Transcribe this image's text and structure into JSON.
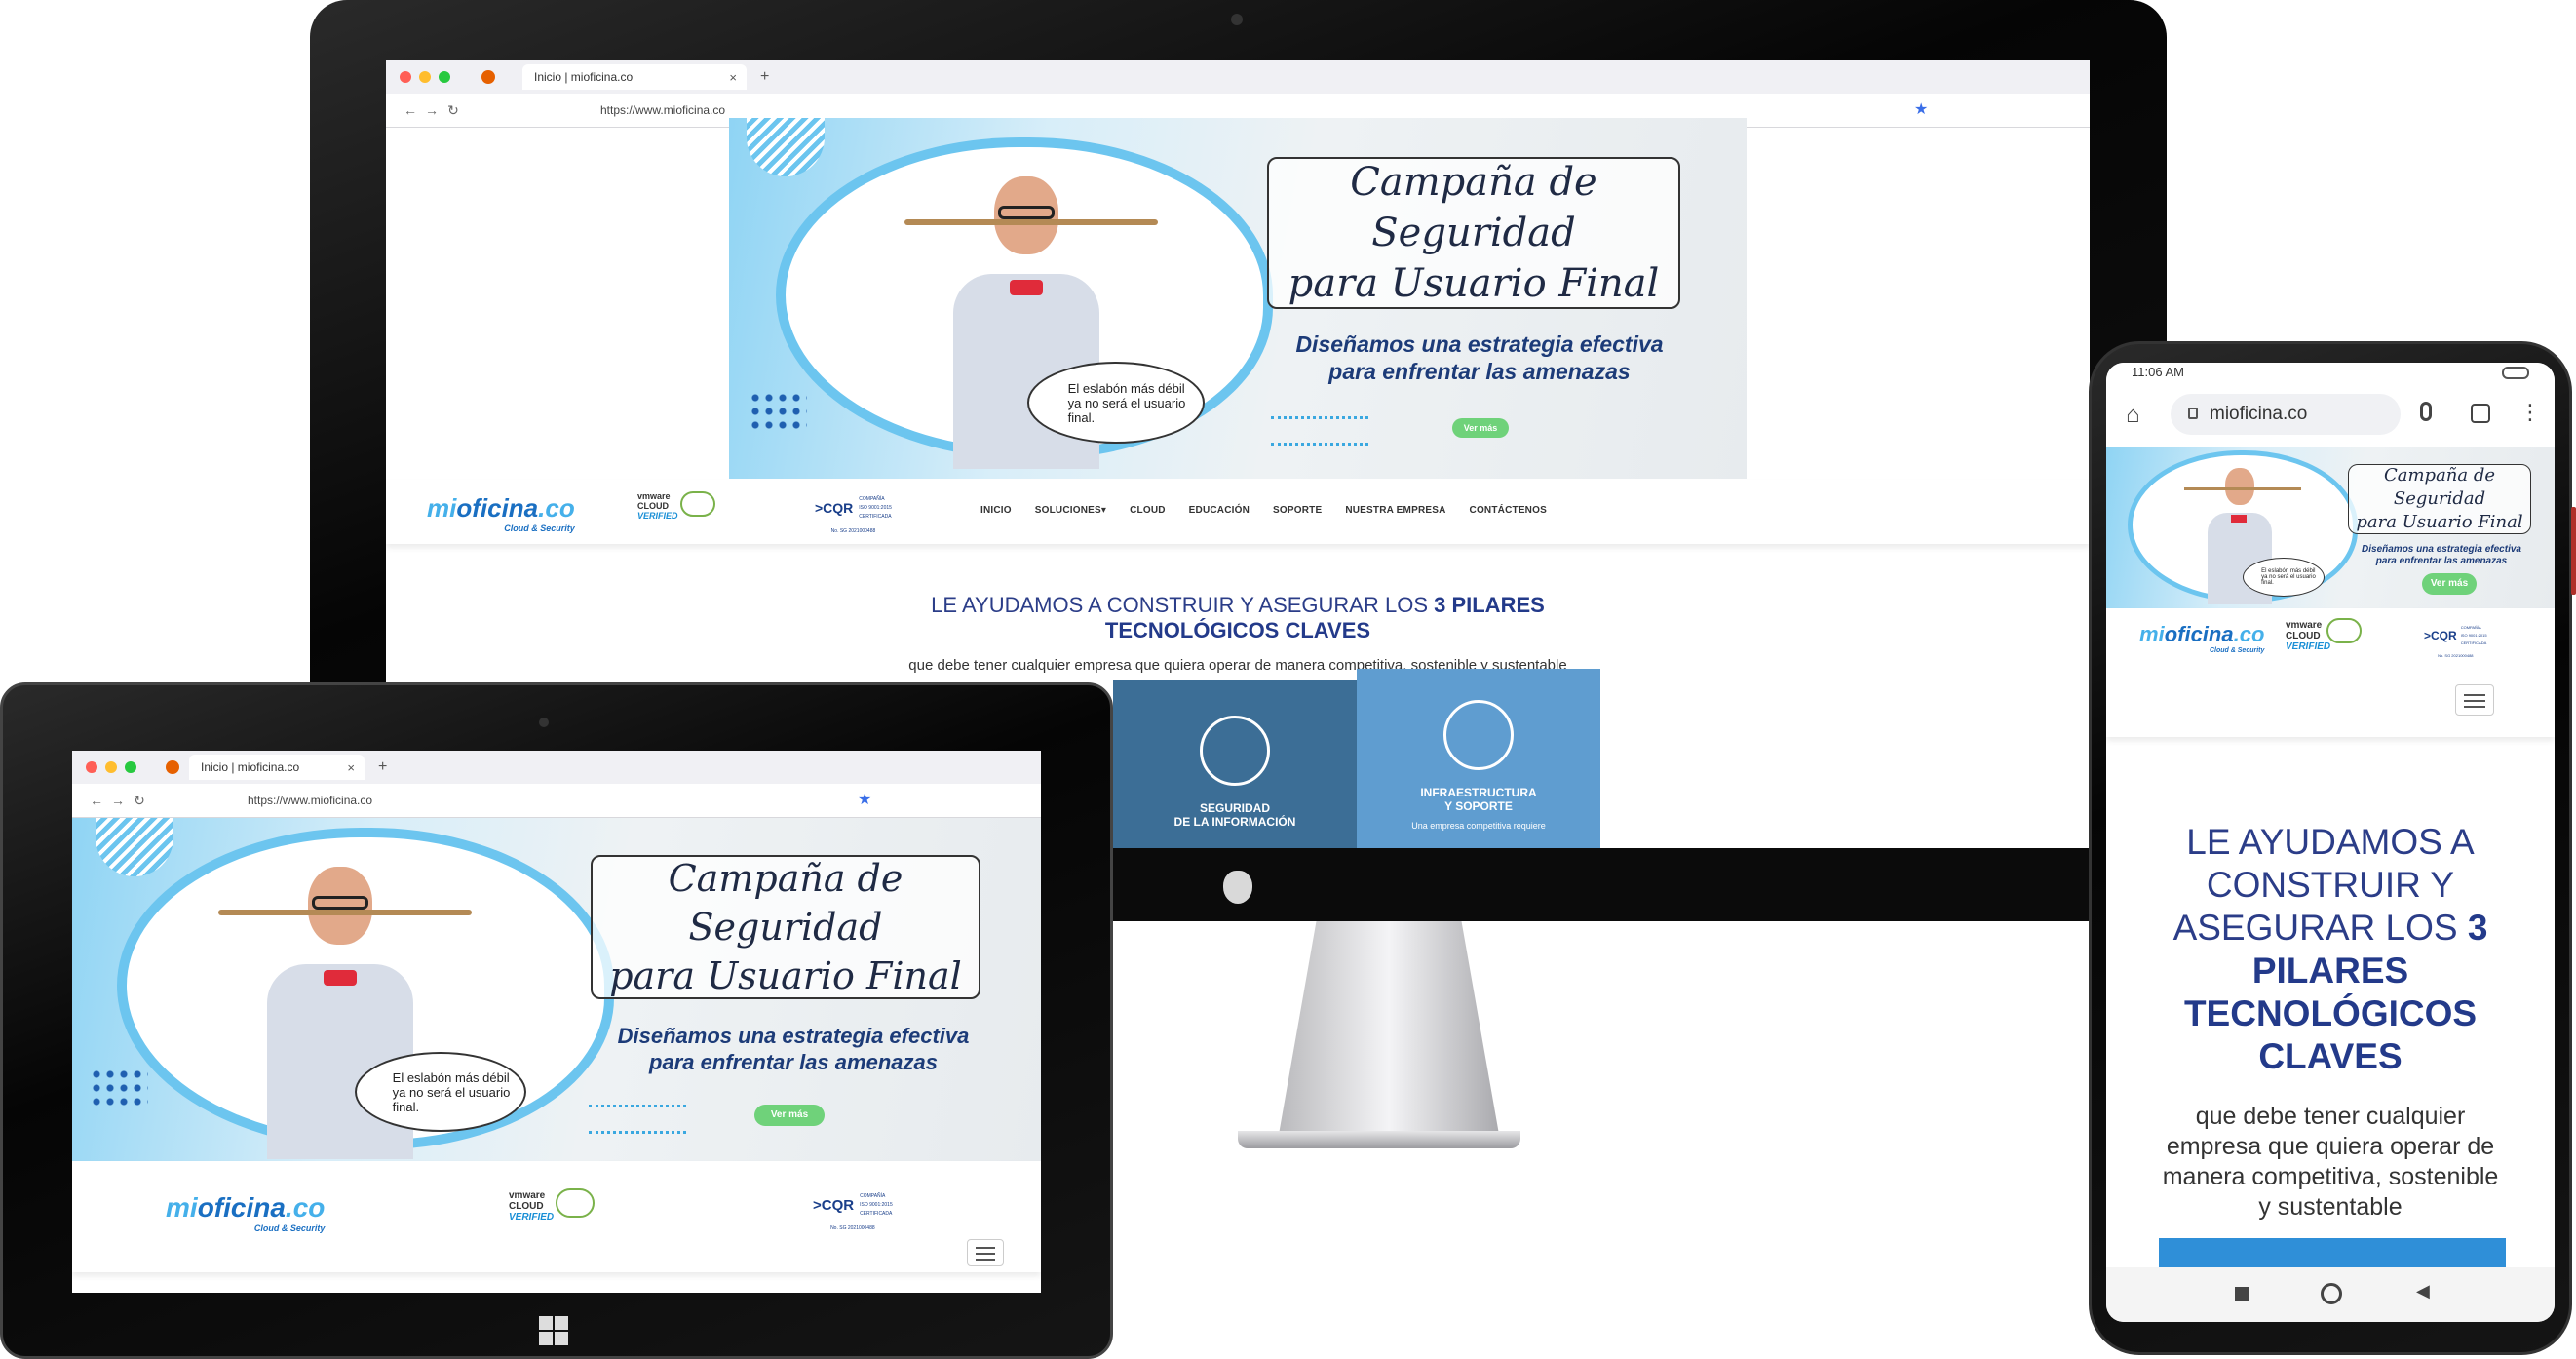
{
  "browser": {
    "tab_title": "Inicio | mioficina.co",
    "url": "https://www.mioficina.co",
    "mobile_url": "mioficina.co",
    "mobile_time": "11:06 AM"
  },
  "hero": {
    "campaign_line1": "Campaña de Seguridad",
    "campaign_line2": "para Usuario Final",
    "tagline_line1": "Diseñamos una estrategia efectiva",
    "tagline_line2": "para enfrentar las amenazas",
    "bubble_line1": "El eslabón más débil",
    "bubble_line2": "ya no será el usuario",
    "bubble_line3": "final.",
    "cta": "Ver más"
  },
  "logos": {
    "mio_a": "mi",
    "mio_b": "oficina",
    "mio_c": ".co",
    "mio_sub": "Cloud & Security",
    "vm_top": "vmware",
    "vm_mid": "CLOUD",
    "vm_bot": "VERIFIED",
    "cqr": ">CQR",
    "cqr_l1": "COMPAÑÍA",
    "cqr_l2": "ISO 9001:2015",
    "cqr_l3": "CERTIFICADA",
    "cqr_no": "No. SG 2021000488"
  },
  "nav": {
    "items": [
      "INICIO",
      "SOLUCIONES▾",
      "CLOUD",
      "EDUCACIÓN",
      "SOPORTE",
      "NUESTRA EMPRESA",
      "CONTÁCTENOS"
    ]
  },
  "content": {
    "heading_a": "LE AYUDAMOS A CONSTRUIR Y ASEGURAR LOS ",
    "heading_b": "3 PILARES",
    "heading_c": "TECNOLÓGICOS CLAVES",
    "subtext": "que debe tener cualquier empresa que quiera operar de manera competitiva, sostenible y sustentable",
    "card1_l1": "SEGURIDAD",
    "card1_l2": "DE LA INFORMACIÓN",
    "card2_l1": "INFRAESTRUCTURA",
    "card2_l2": "Y SOPORTE",
    "card2_desc": "Una empresa competitiva requiere",
    "mobile_h1": "LE AYUDAMOS A",
    "mobile_h2": "CONSTRUIR Y",
    "mobile_h3a": "ASEGURAR LOS ",
    "mobile_h3b": "3",
    "mobile_h4": "PILARES",
    "mobile_h5": "TECNOLÓGICOS",
    "mobile_h6": "CLAVES",
    "mobile_s1": "que debe tener cualquier",
    "mobile_s2": "empresa que quiera operar de",
    "mobile_s3": "manera competitiva, sostenible",
    "mobile_s4": "y sustentable"
  },
  "colors": {
    "brand_blue": "#2b3d88",
    "light_blue": "#6cc5ef",
    "cta_green": "#6fd27a"
  }
}
